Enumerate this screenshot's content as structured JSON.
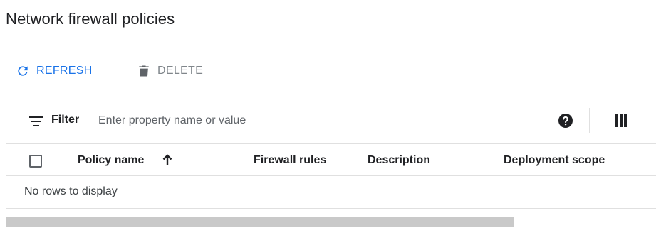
{
  "page": {
    "title": "Network firewall policies"
  },
  "actions": {
    "refresh_label": "REFRESH",
    "refresh_icon": "refresh-icon",
    "delete_label": "DELETE",
    "delete_icon": "trash-icon",
    "refresh_color": "#1a73e8",
    "delete_color": "#80868b"
  },
  "filter": {
    "label": "Filter",
    "placeholder": "Enter property name or value",
    "value": "",
    "icons": [
      "filter-icon",
      "help-icon",
      "column-display-icon"
    ]
  },
  "table": {
    "columns": [
      {
        "label": "Policy name",
        "sorted": "ascending"
      },
      {
        "label": "Firewall rules"
      },
      {
        "label": "Description"
      },
      {
        "label": "Deployment scope"
      }
    ],
    "rows": [],
    "empty_message": "No rows to display"
  }
}
